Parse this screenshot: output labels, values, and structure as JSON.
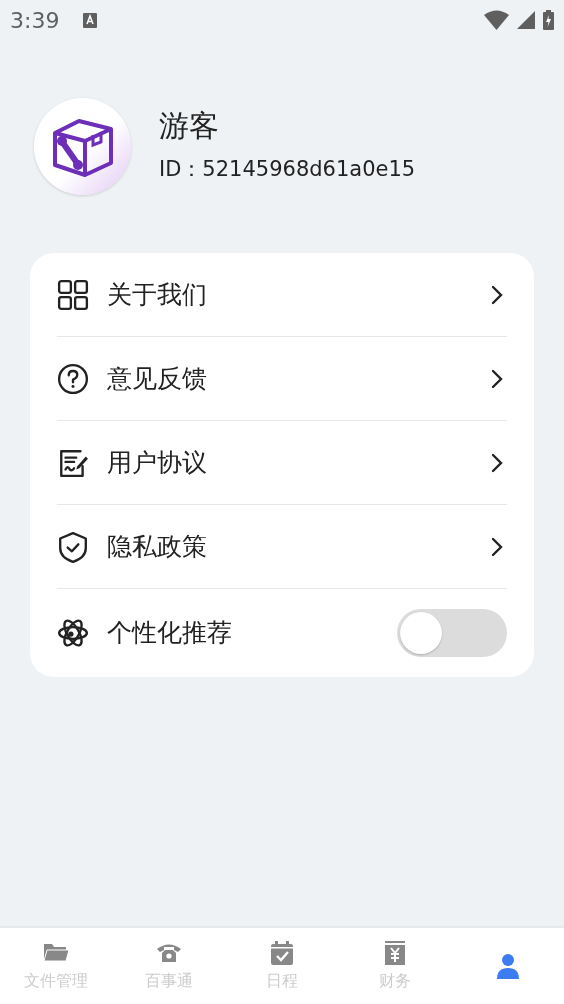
{
  "status_bar": {
    "time": "3:39"
  },
  "profile": {
    "name": "游客",
    "id": "ID：52145968d61a0e15"
  },
  "menu": [
    {
      "kind": "link",
      "label": "关于我们"
    },
    {
      "kind": "link",
      "label": "意见反馈"
    },
    {
      "kind": "link",
      "label": "用户协议"
    },
    {
      "kind": "link",
      "label": "隐私政策"
    },
    {
      "kind": "toggle",
      "label": "个性化推荐",
      "on": false
    }
  ],
  "tabs": [
    {
      "label": "文件管理",
      "selected": false
    },
    {
      "label": "百事通",
      "selected": false
    },
    {
      "label": "日程",
      "selected": false
    },
    {
      "label": "财务",
      "selected": false
    },
    {
      "selected": true
    }
  ]
}
